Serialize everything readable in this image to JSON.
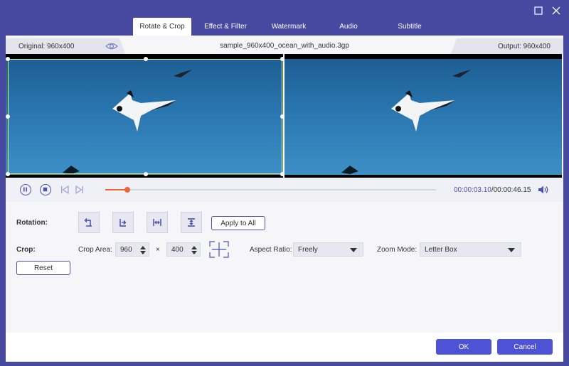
{
  "window": {
    "icons": [
      "maximize-icon",
      "close-icon"
    ]
  },
  "tabs": [
    {
      "label": "Rotate & Crop",
      "active": true
    },
    {
      "label": "Effect & Filter",
      "active": false
    },
    {
      "label": "Watermark",
      "active": false
    },
    {
      "label": "Audio",
      "active": false
    },
    {
      "label": "Subtitle",
      "active": false
    }
  ],
  "preview": {
    "original_label": "Original: 960x400",
    "filename": "sample_960x400_ocean_with_audio.3gp",
    "output_label": "Output: 960x400"
  },
  "playback": {
    "current_time": "00:00:03.10",
    "separator": "/",
    "total_time": "00:00:46.15",
    "progress": 0.067
  },
  "rotation": {
    "label": "Rotation:",
    "apply_label": "Apply to All"
  },
  "crop": {
    "label": "Crop:",
    "area_label": "Crop Area:",
    "width": "960",
    "height": "400",
    "times": "×",
    "aspect_label": "Aspect Ratio:",
    "aspect_value": "Freely",
    "zoom_label": "Zoom Mode:",
    "zoom_value": "Letter Box",
    "reset_label": "Reset"
  },
  "footer": {
    "ok_label": "OK",
    "cancel_label": "Cancel"
  },
  "colors": {
    "accent": "#4e52d4",
    "frame": "#4749a0",
    "progress": "#f0663a",
    "crop_border": "#f2e84a"
  }
}
